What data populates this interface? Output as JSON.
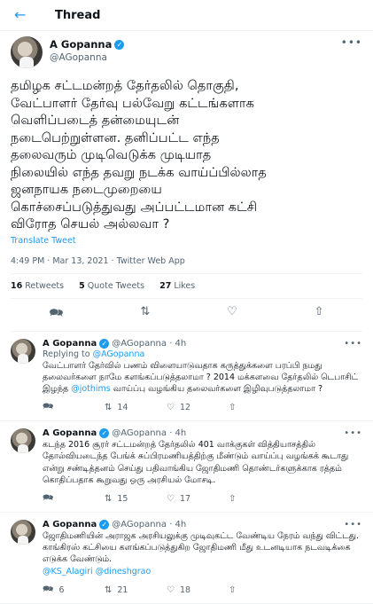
{
  "header": {
    "back_icon": "arrow-left-icon",
    "title": "Thread"
  },
  "main_tweet": {
    "name": "A Gopanna",
    "handle": "@AGopanna",
    "text_lines": [
      "தமிழக சட்டமன்றத் தேர்தலில் தொகுதி,",
      "வேட்பாளர் தேர்வு பல்வேறு கட்டங்களாக",
      "வெளிப்படைத் தன்மையுடன்",
      "நடைபெற்றுள்ளன. தனிப்பட்ட எந்த",
      "தலைவரும் முடிவெடுக்க முடியாத",
      "நிலையில் எந்த தவறு நடக்க வாய்ப்பில்லாத",
      "ஜனநாயக நடைமுறையை",
      "கொச்சைப்படுத்துவது அப்பட்டமான கட்சி",
      "விரோத செயல் அல்லவா ?"
    ],
    "translate": "Translate Tweet",
    "meta": "4:49 PM · Mar 13, 2021 · Twitter Web App",
    "retweets_count": "16",
    "retweets_label": "Retweets",
    "quotes_count": "5",
    "quotes_label": "Quote Tweets",
    "likes_count": "27",
    "likes_label": "Likes"
  },
  "replies": [
    {
      "name": "A Gopanna",
      "handle": "@AGopanna · 4h",
      "replying_prefix": "Replying to ",
      "replying_to": "@AGopanna",
      "text_before": "வேட்பாளர் தேர்வில் பணம் விளையாடுவதாக கருத்துக்களை பரப்பி நமது தலைவர்களை நாமே களங்கப்படுத்தலாமா ? 2014 மக்களவை தேர்தலில் டெபாசிட் இழந்த ",
      "mention": "@jothims",
      "text_after": " வாய்ப்பு வழங்கிய தலைவர்களை இழிவுபடுத்தலாமா ?",
      "reply_count": "",
      "retweet_count": "14",
      "like_count": "12"
    },
    {
      "name": "A Gopanna",
      "handle": "@AGopanna · 4h",
      "text_before": "கடந்த 2016 சூரர் சட்டமன்றத் தேர்தலில் 401 வாக்குகள் வித்தியாசத்தில் தோல்வியடைந்த பேங்க் சுப்பிரமணியத்திற்கு மீண்டும் வாய்ப்பு வழங்கக் கூடாது என்று சண்டித்தனம் செய்து பதிவாங்கிய ஜோதிமணி தொண்டர்களுக்காக ரத்தம் கொதிப்பதாக கூறுவது ஒரு அரசியல் மோசடி.",
      "mention": "",
      "text_after": "",
      "reply_count": "",
      "retweet_count": "15",
      "like_count": "17"
    },
    {
      "name": "A Gopanna",
      "handle": "@AGopanna · 4h",
      "text_before": "ஜோதிமணியின் அராஜக அரசியலுக்கு முடிவுகட்ட வேண்டிய நேரம் வந்து விட்டது. காங்கிரஸ் கட்சியை களங்கப்படுத்துகிற ஜோதிமணி மீது உடனடியாக நடவடிக்கை எடுக்க வேண்டும்.",
      "mention": "@KS_Alagiri @dineshgrao",
      "text_after": "",
      "reply_count": "6",
      "retweet_count": "21",
      "like_count": "18"
    }
  ],
  "icons": {
    "more": "more-icon",
    "reply": "reply-icon",
    "retweet": "retweet-icon",
    "like": "heart-icon",
    "share": "share-icon",
    "verified": "verified-badge-icon"
  },
  "colors": {
    "accent": "#1d9bf0",
    "muted": "#536471",
    "divider": "#eff3f4"
  }
}
